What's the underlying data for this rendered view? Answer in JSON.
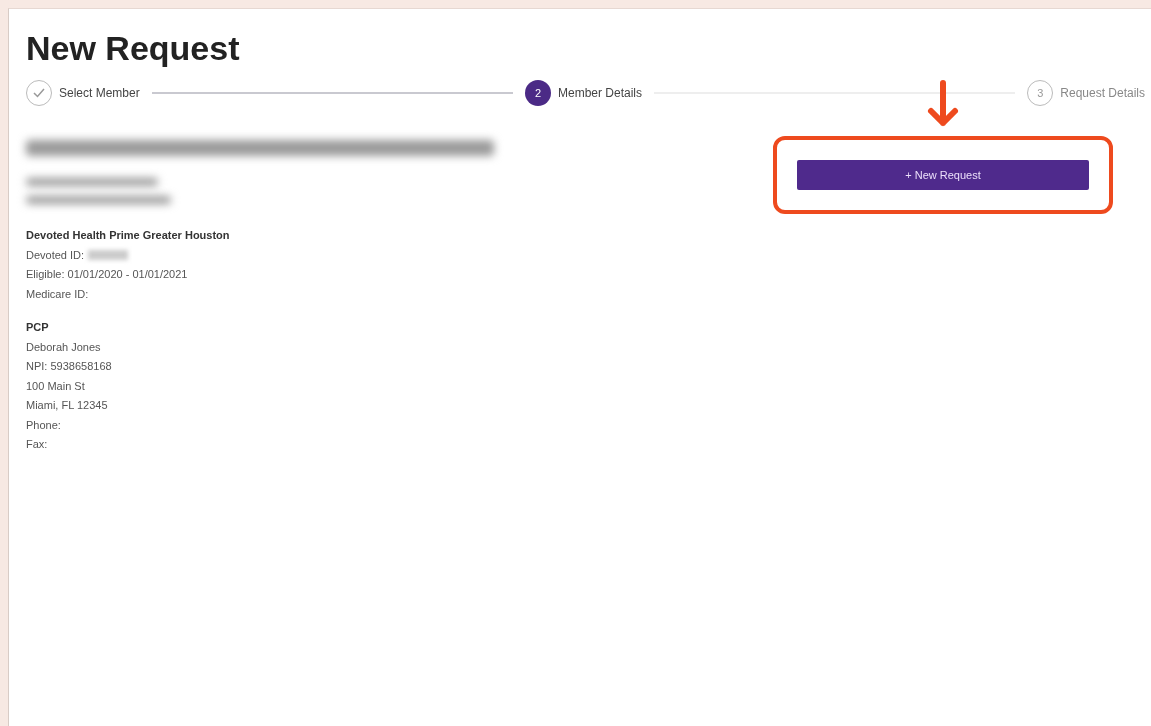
{
  "title": "New Request",
  "steps": [
    {
      "label": "Select Member",
      "completed": true,
      "selected": false
    },
    {
      "label": "Member Details",
      "number": "2",
      "completed": false,
      "selected": true
    },
    {
      "label": "Request Details",
      "number": "3",
      "completed": false,
      "selected": false
    }
  ],
  "member": {
    "plan": "Devoted Health Prime Greater Houston",
    "lines": [
      "Devoted ID:",
      "Eligible: 01/01/2020 - 01/01/2021",
      "Medicare ID:"
    ]
  },
  "pcp": {
    "heading": "PCP",
    "lines": [
      "Deborah Jones",
      "NPI: 5938658168",
      "100 Main St",
      "Miami, FL 12345",
      "Phone:",
      "Fax:"
    ]
  },
  "action": {
    "label": "+ New Request"
  }
}
